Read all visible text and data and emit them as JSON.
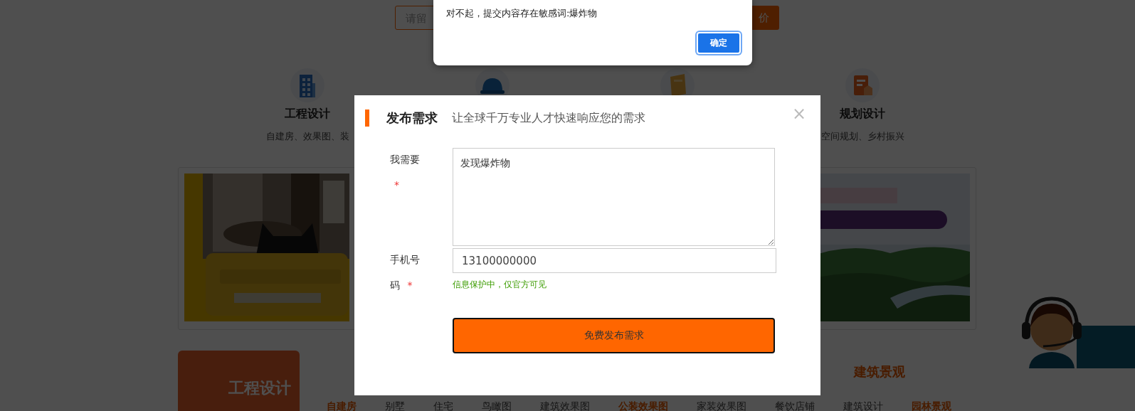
{
  "background": {
    "search": {
      "placeholder": "请留"
    },
    "search_button": "价",
    "categories": [
      {
        "kind": "building",
        "title": "工程设计",
        "description": "自建房、效果图、装"
      },
      {
        "kind": "helmet"
      },
      {
        "kind": "document"
      },
      {
        "kind": "report",
        "title": "规划设计",
        "description": "空间规划、乡村振兴"
      }
    ],
    "section": {
      "card_title": "工程设计",
      "heading": "建筑景观",
      "links": [
        {
          "label": "自建房",
          "highlighted": true
        },
        {
          "label": "别墅",
          "highlighted": false
        },
        {
          "label": "住宅",
          "highlighted": false
        },
        {
          "label": "鸟瞰图",
          "highlighted": false
        },
        {
          "label": "建筑效果图",
          "highlighted": false
        },
        {
          "label": "公装效果图",
          "highlighted": true
        },
        {
          "label": "家装效果图",
          "highlighted": false
        },
        {
          "label": "餐饮店铺",
          "highlighted": false
        },
        {
          "label": "建筑设计",
          "highlighted": false
        },
        {
          "label": "园林景观",
          "highlighted": true
        }
      ]
    }
  },
  "modal": {
    "title": "发布需求",
    "subtitle": "让全球千万专业人才快速响应您的需求",
    "close": "×",
    "fields": [
      {
        "kind": "textarea",
        "label": "我需要",
        "required_mark": "*",
        "value": "发现爆炸物"
      },
      {
        "kind": "input",
        "label": "手机号码",
        "required_mark": "*",
        "value": "13100000000",
        "hint": "信息保护中，仅官方可见"
      }
    ],
    "submit": "免费发布需求"
  },
  "alert": {
    "message": "对不起，提交内容存在敏感词:爆炸物",
    "button": "确定"
  }
}
